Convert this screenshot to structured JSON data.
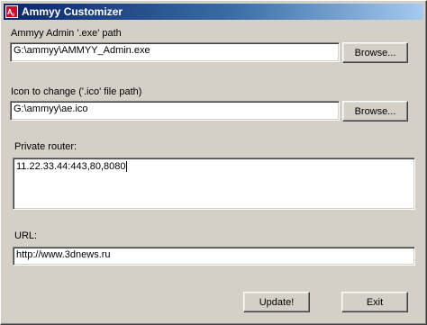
{
  "window": {
    "title": "Ammyy Customizer",
    "icon": "ammyy-app-icon"
  },
  "exe_section": {
    "label": "Ammyy Admin '.exe' path",
    "value": "G:\\ammyy\\AMMYY_Admin.exe",
    "browse_label": "Browse..."
  },
  "icon_section": {
    "label": "Icon to change ('.ico' file path)",
    "value": "G:\\ammyy\\ae.ico",
    "browse_label": "Browse..."
  },
  "router_section": {
    "label": "Private router:",
    "value": "11.22.33.44:443,80,8080"
  },
  "url_section": {
    "label": "URL:",
    "value": "http://www.3dnews.ru"
  },
  "footer": {
    "update_label": "Update!",
    "exit_label": "Exit"
  },
  "colors": {
    "title_start": "#0a246a",
    "title_end": "#a6caf0",
    "dialog_bg": "#d4d0c8",
    "icon_red": "#c8102e"
  }
}
